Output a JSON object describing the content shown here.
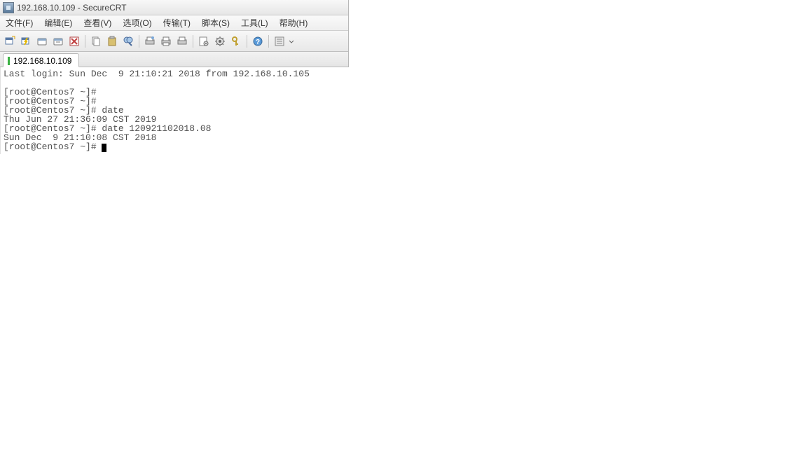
{
  "titlebar": {
    "title": "192.168.10.109 - SecureCRT"
  },
  "menu": {
    "file": "文件(F)",
    "edit": "编辑(E)",
    "view": "查看(V)",
    "options": "选项(O)",
    "transfer": "传输(T)",
    "script": "脚本(S)",
    "tools": "工具(L)",
    "help": "帮助(H)"
  },
  "toolbar_icons": {
    "new_session": "new-session",
    "quick_connect": "quick-connect",
    "reconnect": "reconnect",
    "disconnect": "disconnect",
    "cancel": "cancel",
    "copy": "copy",
    "paste": "paste",
    "find": "find",
    "print_setup": "print-setup",
    "print": "print",
    "print_screen": "print-screen",
    "session_options": "session-options",
    "global_options": "global-options",
    "keymap": "keymap",
    "help": "help",
    "properties": "properties"
  },
  "tab": {
    "label": "192.168.10.109"
  },
  "terminal": {
    "lines": [
      "Last login: Sun Dec  9 21:10:21 2018 from 192.168.10.105",
      "",
      "[root@Centos7 ~]#",
      "[root@Centos7 ~]#",
      "[root@Centos7 ~]# date",
      "Thu Jun 27 21:36:09 CST 2019",
      "[root@Centos7 ~]# date 120921102018.08",
      "Sun Dec  9 21:10:08 CST 2018",
      "[root@Centos7 ~]# "
    ]
  }
}
